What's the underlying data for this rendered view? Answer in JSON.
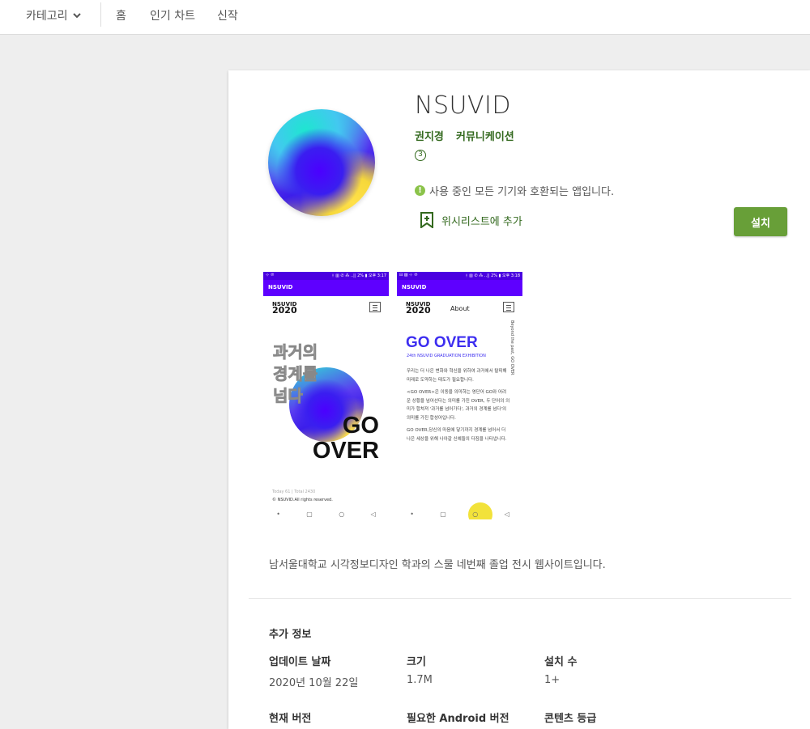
{
  "nav": {
    "category_label": "카테고리",
    "links": [
      "홈",
      "인기 차트",
      "신작"
    ]
  },
  "app": {
    "title": "NSUVID",
    "developer": "권지경",
    "category": "커뮤니케이션",
    "content_rating_badge": "3",
    "compatibility": "사용 중인 모든 기기와 호환되는 앱입니다.",
    "wishlist_label": "위시리스트에 추가",
    "install_label": "설치",
    "description": "남서울대학교 시각정보디자인 학과의 스물 네번째 졸업 전시 웹사이트입니다."
  },
  "screenshots": [
    {
      "status_left": "⊹ ℗",
      "status_right": "ᚼ ▥ ✆ ⁂ ‥|| 2% ▮ 오후 3:17",
      "appbar_title": "NSUVID",
      "logo_top": "NSUVID",
      "logo_year": "2020",
      "headline_kor": [
        "과거의",
        "경계를",
        "넘다"
      ],
      "headline_en": [
        "GO",
        "OVER"
      ],
      "footer_stats": "Today 61 | Total 2430",
      "footer_copyright": "© NSUVID.All rights reserved.",
      "navbar": [
        "•",
        "▢",
        "○",
        "◁"
      ]
    },
    {
      "status_left": "⊟ ▨ ⊹ ℗",
      "status_right": "ᚼ ▥ ✆ ⁂ ‥|| 2% ▮ 오후 3:18",
      "appbar_title": "NSUVID",
      "logo_top": "NSUVID",
      "logo_year": "2020",
      "about_label": "About",
      "vertical_text": "Beyond the past, GO OVER",
      "headline": "GO OVER",
      "subtitle": "24th NSUVID GRADUATION EXHIBITION",
      "paragraphs": [
        "우리는 더 나은 변화와 혁신을 위하여 과거에서 탈피해 미래로 도약하는 태도가 필요합니다.",
        "<GO OVER>은 이동을 의미하는 영단어 GO와 어려운 상황을 넘어선다는 의미를 가진 OVER, 두 단어의 의미가 합쳐져 '과거를 넘어가다', 과거의 경계를 넘다'의 의미를 가진 합성어입니다.",
        "GO OVER,당신의 마음에 닿기까지 경계를 넘어서 더 나은 세상을 위해 나아갈 신예들의 다짐을 나타냅니다."
      ],
      "navbar": [
        "•",
        "▢",
        "○",
        "◁"
      ]
    }
  ],
  "additional_info": {
    "heading": "추가 정보",
    "fields": [
      {
        "label": "업데이트 날짜",
        "value": "2020년 10월 22일"
      },
      {
        "label": "크기",
        "value": "1.7M"
      },
      {
        "label": "설치 수",
        "value": "1+"
      },
      {
        "label": "현재 버전",
        "value": ""
      },
      {
        "label": "필요한 Android 버전",
        "value": ""
      },
      {
        "label": "콘텐츠 등급",
        "value": ""
      }
    ]
  },
  "colors": {
    "accent_green": "#689f38",
    "text_green": "#33691e",
    "screenshot_purple": "#5e00ff"
  }
}
